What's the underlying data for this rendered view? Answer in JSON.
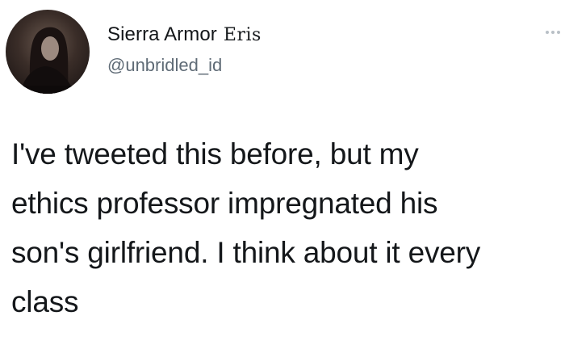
{
  "tweet": {
    "author": {
      "display_name": "Sierra Armor",
      "name_suffix": "Eris",
      "handle": "@unbridled_id",
      "avatar_icon": "profile-photo"
    },
    "more_icon": "more-options-icon",
    "text": "I've tweeted this before, but my\nethics professor impregnated his\nson's girlfriend. I think about it every\nclass"
  }
}
